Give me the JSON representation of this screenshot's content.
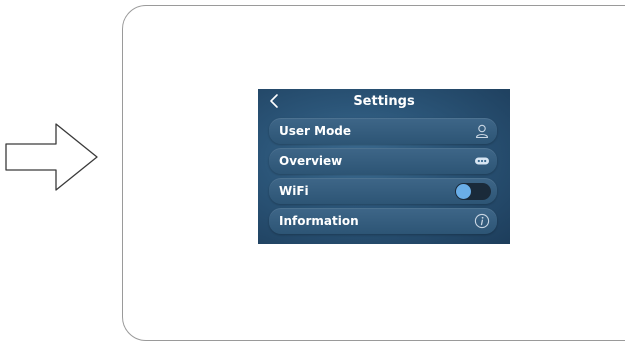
{
  "header": {
    "title": "Settings",
    "back_icon": "chevron-left-icon"
  },
  "menu": {
    "items": [
      {
        "label": "User Mode",
        "icon": "user-icon"
      },
      {
        "label": "Overview",
        "icon": "ellipsis-icon"
      },
      {
        "label": "WiFi",
        "icon": "toggle-switch",
        "toggle_on": false
      },
      {
        "label": "Information",
        "icon": "info-icon"
      }
    ]
  },
  "colors": {
    "screen_bg": "#2b5578",
    "row_bg": "#35607f",
    "toggle_knob": "#6aaee8",
    "text": "#ffffff"
  }
}
